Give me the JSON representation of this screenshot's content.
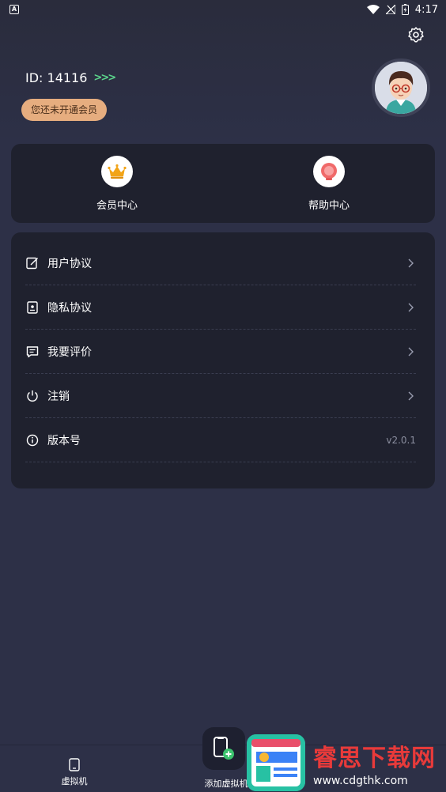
{
  "status_bar": {
    "time": "4:17",
    "notification_letter": "A"
  },
  "profile": {
    "id_text": "ID: 14116",
    "arrows": ">>>",
    "vip_badge": "您还未开通会员"
  },
  "quick": [
    {
      "label": "会员中心",
      "icon": "crown-icon"
    },
    {
      "label": "帮助中心",
      "icon": "help-bulb-icon"
    }
  ],
  "menu": [
    {
      "label": "用户协议",
      "icon": "edit-doc-icon",
      "value": ""
    },
    {
      "label": "隐私协议",
      "icon": "privacy-doc-icon",
      "value": ""
    },
    {
      "label": "我要评价",
      "icon": "comment-icon",
      "value": ""
    },
    {
      "label": "注销",
      "icon": "power-icon",
      "value": ""
    },
    {
      "label": "版本号",
      "icon": "info-icon",
      "value": "v2.0.1"
    }
  ],
  "bottom_nav": [
    {
      "label": "虚拟机",
      "icon": "tablet-icon"
    },
    {
      "label": "添加虚拟机",
      "icon": "add-device-icon"
    }
  ],
  "watermark": {
    "title": "睿思下载网",
    "url": "www.cdgthk.com"
  },
  "colors": {
    "background": "#2d3047",
    "card": "#1f212e",
    "vip_badge": "#e6ad7f",
    "accent_arrows": "#5bd38b",
    "watermark_red": "#e83a3a"
  }
}
